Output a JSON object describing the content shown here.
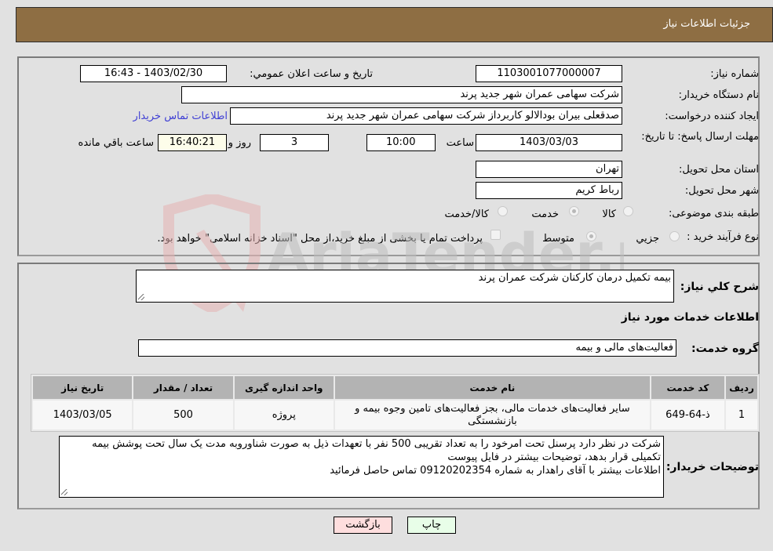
{
  "header": {
    "title": "جزئیات اطلاعات نیاز"
  },
  "form": {
    "need_number": {
      "label": "شماره نیاز:",
      "value": "1103001077000007"
    },
    "announce_datetime": {
      "label": "تاریخ و ساعت اعلان عمومي:",
      "value": "1403/02/30 - 16:43"
    },
    "buyer_org": {
      "label": "نام دستگاه خریدار:",
      "value": "شرکت سهامی عمران شهر جدید پرند"
    },
    "requester": {
      "label": "ایجاد کننده درخواست:",
      "value": "صدقعلی بیران بودالالو کاربرداز شرکت سهامی عمران شهر جدید پرند"
    },
    "buyer_contact_link": "اطلاعات تماس خریدار",
    "deadline": {
      "label": "مهلت ارسال پاسخ: تا تاریخ:",
      "date": "1403/03/03",
      "time_label": "ساعت",
      "time": "10:00",
      "days": "3",
      "days_label": "روز و",
      "remaining": "16:40:21",
      "remaining_label": "ساعت باقي مانده"
    },
    "province": {
      "label": "استان محل تحویل:",
      "value": "تهران"
    },
    "city": {
      "label": "شهر محل تحویل:",
      "value": "رباط کریم"
    },
    "category": {
      "label": "طبقه بندی موضوعی:",
      "options": [
        "کالا",
        "خدمت",
        "کالا/خدمت"
      ],
      "selected": "خدمت"
    },
    "purchase_type": {
      "label": "نوع فرآیند خرید :",
      "options": [
        "جزيي",
        "متوسط"
      ],
      "selected": "متوسط",
      "treasury_note": "پرداخت تمام یا بخشی از مبلغ خرید،از محل \"اسناد خزانه اسلامی\" خواهد بود."
    }
  },
  "details": {
    "description_label": "شرح كلي نياز:",
    "description": "بیمه تکمیل درمان کارکنان شرکت عمران پرند",
    "services_heading": "اطلاعات خدمات مورد نیاز",
    "service_group_label": "گروه خدمت:",
    "service_group": "فعالیت‌های مالی و بیمه",
    "table": {
      "headers": [
        "ردیف",
        "کد خدمت",
        "نام خدمت",
        "واحد اندازه گیری",
        "تعداد / مقدار",
        "تاریخ نیاز"
      ],
      "rows": [
        [
          "1",
          "ذ-64-649",
          "سایر فعالیت‌های خدمات مالی، بجز فعالیت‌های تامین وجوه بیمه و بازنشستگی",
          "پروژه",
          "500",
          "1403/03/05"
        ]
      ]
    },
    "buyer_notes_label": "توضیحات خریدار:",
    "buyer_notes": [
      "شرکت در نظر دارد پرسنل تحت امرخود را به تعداد تقریبی 500 نفر با تعهدات ذیل  به صورت شناوروبه مدت یک سال تحت پوشش بیمه تکمیلی قرار بدهد، توضیحات بیشتر در فایل پیوست",
      "اطلاعات بیشتر با آقای راهدار به شماره 09120202354 تماس حاصل فرمائید"
    ]
  },
  "buttons": {
    "print": "چاپ",
    "back": "بازگشت"
  },
  "watermark": {
    "text": "AriaTender.neT"
  },
  "colors": {
    "header_bg": "#8e6e43",
    "link": "#3f3fd4",
    "back_btn": "#fedede",
    "print_btn": "#e8fee8",
    "remaining_bg": "#fdfdea"
  }
}
